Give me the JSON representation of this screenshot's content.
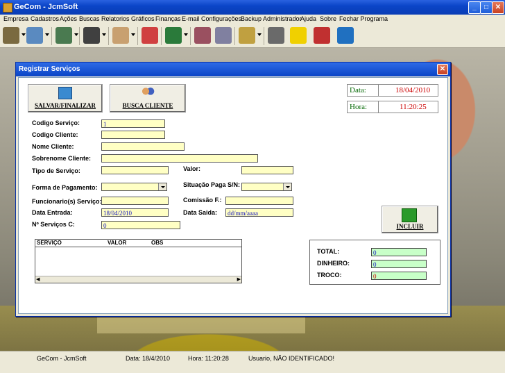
{
  "app": {
    "title": "GeCom - JcmSoft"
  },
  "menu": [
    "Empresa",
    "Cadastros",
    "Ações",
    "Buscas",
    "Relatorios",
    "Gráficos",
    "Finanças",
    "E-mail",
    "Configurações",
    "Backup",
    "Administrador",
    "Ajuda",
    "Sobre",
    "Fechar Programa"
  ],
  "dialog": {
    "title": "Registrar Serviços",
    "buttons": {
      "save": "SALVAR/FINALIZAR",
      "search_client": "BUSCA CLIENTE",
      "include": "INCLUIR"
    },
    "date_label": "Data:",
    "date_value": "18/04/2010",
    "time_label": "Hora:",
    "time_value": "11:20:25",
    "labels": {
      "codigo_servico": "Codigo Serviço:",
      "codigo_cliente": "Codigo Cliente:",
      "nome_cliente": "Nome Cliente:",
      "sobrenome_cliente": "Sobrenome Cliente:",
      "tipo_servico": "Tipo de Serviço:",
      "valor": "Valor:",
      "forma_pagamento": "Forma de Pagamento:",
      "situacao_paga": "Situação Paga S/N:",
      "funcionario": "Funcionario(s) Serviço:",
      "comissao": "Comissão F.:",
      "data_entrada": "Data Entrada:",
      "data_saida": "Data Saida:",
      "num_servicos": "Nº Serviços C:"
    },
    "values": {
      "codigo_servico": "1",
      "data_entrada": "18/04/2010",
      "data_saida": "dd/mm/aaaa",
      "num_servicos": "0"
    },
    "grid_headers": [
      "SERVIÇO",
      "VALOR",
      "OBS"
    ],
    "totals": {
      "total_label": "TOTAL:",
      "total_value": "0",
      "dinheiro_label": "DINHEIRO:",
      "dinheiro_value": "0",
      "troco_label": "TROCO:",
      "troco_value": "0"
    }
  },
  "statusbar": {
    "app": "GeCom - JcmSoft",
    "date": "Data: 18/4/2010",
    "time": "Hora: 11:20:28",
    "user": "Usuario, NÃO IDENTIFICADO!"
  },
  "colors": {
    "field_bg": "#ffffc4",
    "total_bg": "#c8ffc8",
    "date_red": "#cc0000",
    "label_green": "#006600"
  }
}
